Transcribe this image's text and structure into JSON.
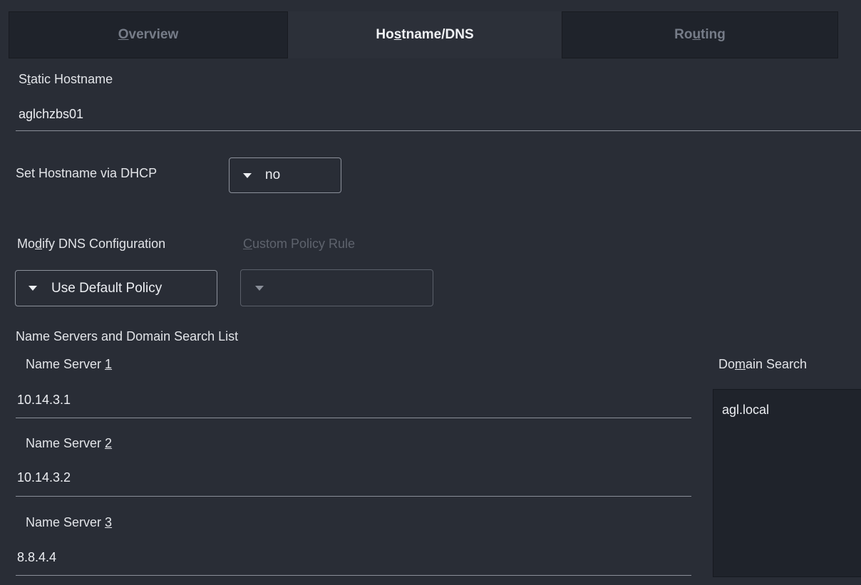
{
  "tabs": [
    {
      "label_parts": [
        "",
        "O",
        "verview"
      ],
      "state": "inactive"
    },
    {
      "label_parts": [
        "Ho",
        "s",
        "tname/DNS"
      ],
      "state": "active"
    },
    {
      "label_parts": [
        "Ro",
        "u",
        "ting"
      ],
      "state": "inactive"
    }
  ],
  "static_hostname": {
    "label_parts": [
      "S",
      "t",
      "atic Hostname"
    ],
    "value": "aglchzbs01"
  },
  "dhcp_hostname": {
    "label": "Set Hostname via DHCP",
    "value": "no"
  },
  "dns_config": {
    "label_parts": [
      "Mo",
      "d",
      "ify DNS Configuration"
    ],
    "policy_rule_label_parts": [
      "",
      "C",
      "ustom Policy Rule"
    ],
    "policy_value": "Use Default Policy",
    "custom_rule_value": ""
  },
  "name_servers_section": {
    "title": "Name Servers and Domain Search List",
    "servers": [
      {
        "label": "Name Server ",
        "mnemonic": "1",
        "value": "10.14.3.1"
      },
      {
        "label": "Name Server ",
        "mnemonic": "2",
        "value": "10.14.3.2"
      },
      {
        "label": "Name Server ",
        "mnemonic": "3",
        "value": "8.8.4.4"
      }
    ],
    "domain_search": {
      "label_parts": [
        "Do",
        "m",
        "ain Search"
      ],
      "value": "agl.local"
    }
  }
}
